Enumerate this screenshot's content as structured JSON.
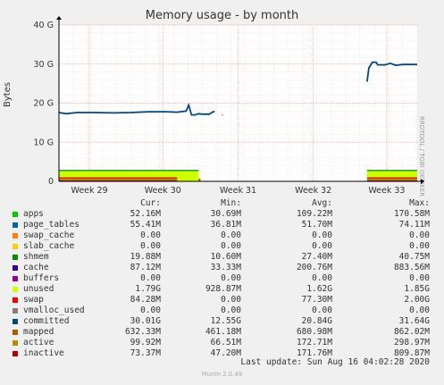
{
  "chart_data": {
    "type": "area",
    "title": "Memory usage - by month",
    "ylabel": "Bytes",
    "side_text": "RRDTOOL / TOBI OETIKER",
    "ylim": [
      0,
      40
    ],
    "y_ticks": [
      "0",
      "10 G",
      "20 G",
      "30 G",
      "40 G"
    ],
    "x_ticks": [
      "Week 29",
      "Week 30",
      "Week 31",
      "Week 32",
      "Week 33"
    ],
    "committed_series": [
      {
        "x": 0.0,
        "y": 17.6
      },
      {
        "x": 0.02,
        "y": 17.3
      },
      {
        "x": 0.05,
        "y": 17.6
      },
      {
        "x": 0.1,
        "y": 17.6
      },
      {
        "x": 0.15,
        "y": 17.5
      },
      {
        "x": 0.2,
        "y": 17.6
      },
      {
        "x": 0.25,
        "y": 17.8
      },
      {
        "x": 0.3,
        "y": 17.8
      },
      {
        "x": 0.33,
        "y": 17.7
      },
      {
        "x": 0.355,
        "y": 18.0
      },
      {
        "x": 0.362,
        "y": 19.5
      },
      {
        "x": 0.37,
        "y": 17.0
      },
      {
        "x": 0.38,
        "y": 17.0
      },
      {
        "x": 0.39,
        "y": 17.3
      },
      {
        "x": 0.4,
        "y": 17.2
      },
      {
        "x": 0.42,
        "y": 17.2
      },
      {
        "x": 0.43,
        "y": 17.8
      },
      {
        "x": 0.435,
        "y": 17.8
      },
      {
        "x": 0.455,
        "y": 17.0
      },
      {
        "x": 0.457,
        "y": 17.0
      },
      {
        "x": 0.86,
        "y": 25.5
      },
      {
        "x": 0.865,
        "y": 29.0
      },
      {
        "x": 0.875,
        "y": 30.5
      },
      {
        "x": 0.885,
        "y": 30.5
      },
      {
        "x": 0.89,
        "y": 29.8
      },
      {
        "x": 0.91,
        "y": 29.8
      },
      {
        "x": 0.925,
        "y": 30.2
      },
      {
        "x": 0.94,
        "y": 29.7
      },
      {
        "x": 0.96,
        "y": 29.9
      },
      {
        "x": 0.98,
        "y": 29.9
      },
      {
        "x": 1.0,
        "y": 29.9
      }
    ],
    "columns": [
      "Cur:",
      "Min:",
      "Avg:",
      "Max:"
    ],
    "series": [
      {
        "name": "apps",
        "color": "#00cc00",
        "cur": "52.16M",
        "min": "30.69M",
        "avg": "109.22M",
        "max": "170.58M"
      },
      {
        "name": "page_tables",
        "color": "#0066b3",
        "cur": "55.41M",
        "min": "36.81M",
        "avg": "51.70M",
        "max": "74.11M"
      },
      {
        "name": "swap_cache",
        "color": "#ff8000",
        "cur": "0.00",
        "min": "0.00",
        "avg": "0.00",
        "max": "0.00"
      },
      {
        "name": "slab_cache",
        "color": "#ffcc00",
        "cur": "0.00",
        "min": "0.00",
        "avg": "0.00",
        "max": "0.00"
      },
      {
        "name": "shmem",
        "color": "#330099",
        "cur": "19.88M",
        "min": "10.60M",
        "avg": "27.40M",
        "max": "40.75M"
      },
      {
        "name": "cache",
        "color": "#990099",
        "cur": "87.12M",
        "min": "33.33M",
        "avg": "200.76M",
        "max": "883.56M"
      },
      {
        "name": "buffers",
        "color": "#ccff00",
        "cur": "0.00",
        "min": "0.00",
        "avg": "0.00",
        "max": "0.00"
      },
      {
        "name": "unused",
        "color": "#ff0000",
        "cur": "1.79G",
        "min": "928.87M",
        "avg": "1.62G",
        "max": "1.85G"
      },
      {
        "name": "swap",
        "color": "#808080",
        "cur": "84.28M",
        "min": "0.00",
        "avg": "77.30M",
        "max": "2.00G"
      },
      {
        "name": "vmalloc_used",
        "color": "#008f00",
        "cur": "0.00",
        "min": "0.00",
        "avg": "0.00",
        "max": "0.00"
      },
      {
        "name": "committed",
        "color": "#00487d",
        "cur": "30.01G",
        "min": "12.55G",
        "avg": "20.84G",
        "max": "31.64G"
      },
      {
        "name": "mapped",
        "color": "#b35a00",
        "cur": "632.33M",
        "min": "461.18M",
        "avg": "680.98M",
        "max": "862.02M"
      },
      {
        "name": "active",
        "color": "#b38f00",
        "cur": "99.92M",
        "min": "66.51M",
        "avg": "172.71M",
        "max": "298.97M"
      },
      {
        "name": "inactive",
        "color": "#6b006b",
        "cur": "73.37M",
        "min": "47.20M",
        "avg": "171.76M",
        "max": "809.87M"
      }
    ],
    "legend_colors": [
      "#00cc00",
      "#0066b3",
      "#ff8000",
      "#ffcc00",
      "#008f00",
      "#330099",
      "#990099",
      "#ccff00",
      "#ff0000",
      "#808080",
      "#00487d",
      "#b35a00",
      "#b38f00",
      "#b30000"
    ],
    "legend_names_order": [
      "apps",
      "page_tables",
      "swap_cache",
      "slab_cache",
      "shmem",
      "cache",
      "buffers",
      "unused",
      "swap",
      "vmalloc_used",
      "committed",
      "mapped",
      "active",
      "inactive"
    ],
    "legend": {
      "apps": {
        "cur": "52.16M",
        "min": "30.69M",
        "avg": "109.22M",
        "max": "170.58M"
      },
      "page_tables": {
        "cur": "55.41M",
        "min": "36.81M",
        "avg": "51.70M",
        "max": "74.11M"
      }
    },
    "footer": "Last update: Sun Aug 16 04:02:28 2020",
    "munin": "Munin 2.0.49"
  },
  "rows": [
    {
      "name": "apps",
      "color": "#00cc00",
      "cur": "52.16M",
      "min": "30.69M",
      "avg": "109.22M",
      "max": "170.58M"
    },
    {
      "name": "page_tables",
      "color": "#0066b3",
      "cur": "55.41M",
      "min": "36.81M",
      "avg": "51.70M",
      "max": "74.11M"
    },
    {
      "name": "swap_cache",
      "color": "#ff8000",
      "cur": "0.00",
      "min": "0.00",
      "avg": "0.00",
      "max": "0.00"
    },
    {
      "name": "slab_cache",
      "color": "#ffcc00",
      "cur": "0.00",
      "min": "0.00",
      "avg": "0.00",
      "max": "0.00"
    },
    {
      "name": "shmem",
      "color": "#008f00",
      "cur": "19.88M",
      "min": "10.60M",
      "avg": "27.40M",
      "max": "40.75M"
    },
    {
      "name": "cache",
      "color": "#330099",
      "cur": "87.12M",
      "min": "33.33M",
      "avg": "200.76M",
      "max": "883.56M"
    },
    {
      "name": "buffers",
      "color": "#990099",
      "cur": "0.00",
      "min": "0.00",
      "avg": "0.00",
      "max": "0.00"
    },
    {
      "name": "unused",
      "color": "#ccff00",
      "cur": "1.79G",
      "min": "928.87M",
      "avg": "1.62G",
      "max": "1.85G"
    },
    {
      "name": "swap",
      "color": "#ff0000",
      "cur": "84.28M",
      "min": "0.00",
      "avg": "77.30M",
      "max": "2.00G"
    },
    {
      "name": "vmalloc_used",
      "color": "#808080",
      "cur": "0.00",
      "min": "0.00",
      "avg": "0.00",
      "max": "0.00"
    },
    {
      "name": "committed",
      "color": "#00487d",
      "cur": "30.01G",
      "min": "12.55G",
      "avg": "20.84G",
      "max": "31.64G"
    },
    {
      "name": "mapped",
      "color": "#b35a00",
      "cur": "632.33M",
      "min": "461.18M",
      "avg": "680.98M",
      "max": "862.02M"
    },
    {
      "name": "active",
      "color": "#b38f00",
      "cur": "99.92M",
      "min": "66.51M",
      "avg": "172.71M",
      "max": "298.97M"
    },
    {
      "name": "inactive",
      "color": "#b30000",
      "cur": "73.37M",
      "min": "47.20M",
      "avg": "171.76M",
      "max": "809.87M"
    }
  ],
  "grid_color": "#ff9999",
  "axis_color": "#000000",
  "labels": {
    "title": "Memory usage - by month",
    "ylabel": "Bytes",
    "side": "RRDTOOL / TOBI OETIKER",
    "col_cur": "Cur:",
    "col_min": "Min:",
    "col_avg": "Avg:",
    "col_max": "Max:",
    "footer": "Last update: Sun Aug 16 04:02:28 2020",
    "munin": "Munin 2.0.49"
  }
}
